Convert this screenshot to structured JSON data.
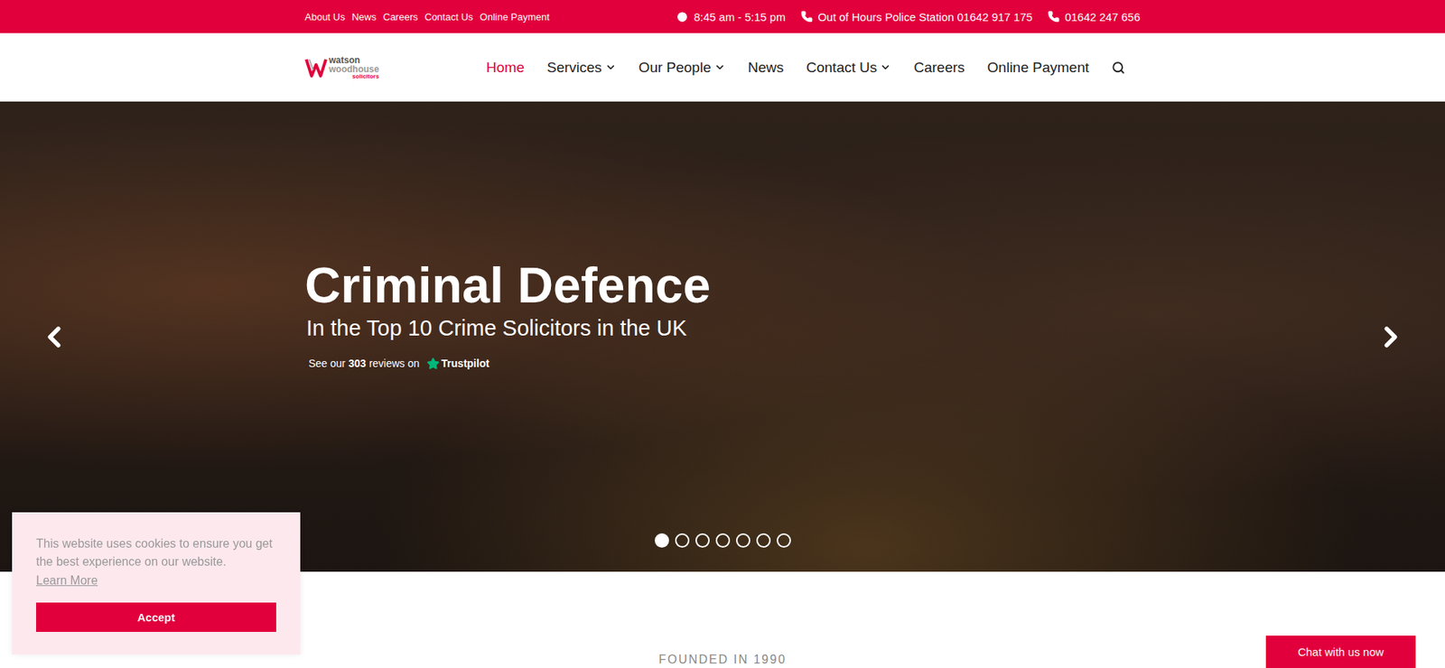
{
  "top_bar": {
    "links": [
      "About Us",
      "News",
      "Careers",
      "Contact Us",
      "Online Payment"
    ],
    "hours": "8:45 am - 5:15 pm",
    "phones": [
      "Out of Hours Police Station 01642 917 175",
      "01642 247 656"
    ]
  },
  "logo": {
    "line1": "watson",
    "line2": "woodhouse",
    "line3": "solicitors"
  },
  "nav": [
    {
      "label": "Home",
      "selected": true,
      "dropdown": false
    },
    {
      "label": "Services",
      "selected": false,
      "dropdown": true
    },
    {
      "label": "Our People",
      "selected": false,
      "dropdown": true
    },
    {
      "label": "News",
      "selected": false,
      "dropdown": false
    },
    {
      "label": "Contact Us",
      "selected": false,
      "dropdown": true
    },
    {
      "label": "Careers",
      "selected": false,
      "dropdown": false
    },
    {
      "label": "Online Payment",
      "selected": false,
      "dropdown": false
    }
  ],
  "hero": {
    "title": "Criminal Defence",
    "subtitle": "In the Top 10 Crime Solicitors in the UK",
    "trustpilot": {
      "prefix": "See our",
      "count": "303",
      "suffix": "reviews on",
      "brand": "Trustpilot"
    },
    "slides": [
      {
        "selected": true
      },
      {
        "selected": false
      },
      {
        "selected": false
      },
      {
        "selected": false
      },
      {
        "selected": false
      },
      {
        "selected": false
      },
      {
        "selected": false
      }
    ]
  },
  "cookie": {
    "message": "This website uses cookies to ensure you get the best experience on our website.",
    "link": "Learn More",
    "button": "Accept"
  },
  "section": {
    "eyebrow": "FOUNDED IN 1990"
  },
  "chat": {
    "label": "Chat with us now"
  }
}
